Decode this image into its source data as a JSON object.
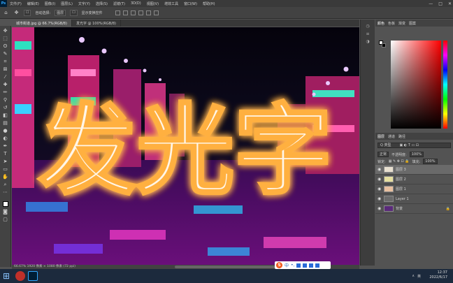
{
  "app": {
    "logo": "Ps",
    "menu": [
      "文件(F)",
      "编辑(E)",
      "图像(I)",
      "图层(L)",
      "文字(Y)",
      "选择(S)",
      "滤镜(T)",
      "3D(D)",
      "视图(V)",
      "增效工具",
      "窗口(W)",
      "帮助(H)"
    ],
    "window_controls": [
      "—",
      "□",
      "✕"
    ]
  },
  "options_bar": {
    "auto_select_label": "自动选择:",
    "auto_select_value": "图层",
    "show_transform_label": "显示变换控件"
  },
  "document_tabs": [
    {
      "label": "城市街道.jpg @ 66.7%(RGB/8)",
      "active": true
    },
    {
      "label": "发光字 @ 100%(RGB/8)",
      "active": false
    }
  ],
  "canvas": {
    "text": "发光字"
  },
  "status": {
    "zoom": "66.67%",
    "doc_info": "1920 像素 × 1080 像素 (72 ppi)"
  },
  "ime": {
    "logo": "S",
    "mode": "中"
  },
  "right_panel": {
    "color_tabs": [
      "颜色",
      "色板",
      "渐变",
      "图案"
    ],
    "layer_tabs": [
      "图层",
      "通道",
      "路径"
    ],
    "search_kind": "Q 类型",
    "blend_mode": "正常",
    "opacity_label": "不透明度:",
    "opacity_value": "100%",
    "lock_label": "锁定:",
    "fill_label": "填充:",
    "fill_value": "100%",
    "layers": [
      {
        "name": "图层 3",
        "selected": true,
        "thumb_color": "#e8e0d0"
      },
      {
        "name": "图层 2",
        "selected": false,
        "thumb_color": "#e6dfa0"
      },
      {
        "name": "图层 1",
        "selected": false,
        "thumb_color": "#e8c0a0"
      },
      {
        "name": "Layer 1",
        "selected": false,
        "thumb_color": "#6a6a6a"
      },
      {
        "name": "背景",
        "selected": false,
        "thumb_color": "#5a2a7a"
      }
    ]
  },
  "taskbar": {
    "time": "12:37",
    "date": "2022/6/17",
    "tray": [
      "∧",
      "英"
    ]
  },
  "colors": {
    "glow": "#ffb040",
    "accent": "#31a8ff",
    "taskbar": "#1c2a3d"
  }
}
